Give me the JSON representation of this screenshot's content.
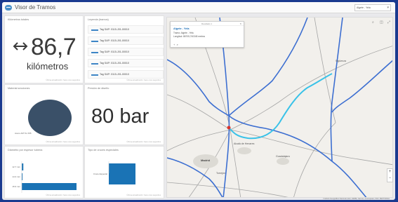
{
  "header": {
    "app_title": "Visor de Tramos",
    "layer_select_value": "Algete - Yela"
  },
  "panels": {
    "distance": {
      "title": "Kilómetros totales",
      "value": "86,7",
      "unit": "kilómetros",
      "foot": "Última actualización: hace unos segundos"
    },
    "legend": {
      "title": "Leyenda (tramos)",
      "items": [
        "Tag SAP: 0115-J01-00010",
        "Tag SAP: 0115-J01-00010",
        "Tag SAP: 0115-J01-00010",
        "Tag SAP: 0115-J01-00010",
        "Tag SAP: 0115-J01-00010"
      ],
      "foot": "Última actualización: hace unos segundos"
    },
    "material": {
      "title": "Material secciones",
      "pie_label": "Acero API 5L X65",
      "foot": "Última actualización: hace unos segundos"
    },
    "pressure": {
      "title": "Presión de diseño",
      "value": "80 bar",
      "foot": "Última actualización: hace unos segundos"
    },
    "diameter": {
      "title": "Diámetro por espesor tubería",
      "bar_labels": [
        "12.7 mm",
        "14.3 mm",
        "15.9 mm"
      ],
      "foot": "Última actualización: hace unos segundos"
    },
    "crossing": {
      "title": "Tipo de cruces especiales",
      "bar_label": "Cruce Especial",
      "foot": "Última actualización: hace unos segundos"
    }
  },
  "chart_data": [
    {
      "type": "pie",
      "title": "Material secciones",
      "slices": [
        {
          "label": "Acero API 5L X65",
          "value": 100
        }
      ]
    },
    {
      "type": "bar",
      "title": "Diámetro por espesor tubería",
      "orientation": "horizontal",
      "categories": [
        "12.7 mm",
        "14.3 mm",
        "15.9 mm"
      ],
      "values": [
        2,
        1,
        70
      ],
      "color": "#1a73b5"
    },
    {
      "type": "bar",
      "title": "Tipo de cruces especiales",
      "orientation": "horizontal",
      "categories": [
        "Cruce Especial"
      ],
      "values": [
        1
      ],
      "color": "#1a73b5"
    }
  ],
  "map": {
    "popup": {
      "pager": "Resultado 1",
      "title": "Algete - Yela",
      "lines": [
        "Tramo: Algete - Yela",
        "Longitud: 86705,740345 metros"
      ]
    },
    "places": [
      {
        "name": "Madrid",
        "bold": true
      },
      {
        "name": "Alcalá de Henares",
        "bold": false
      },
      {
        "name": "Guadalajara",
        "bold": false
      },
      {
        "name": "Torrejón",
        "bold": false
      },
      {
        "name": "Sigüenza",
        "bold": false
      }
    ],
    "attribution": "Instituto Geográfico Nacional, Esri, HERE, Garmin, Foursquare, FAO, METI/NASA",
    "colors": {
      "pipeline": "#39c2e8",
      "rivers": "#3d6fd1",
      "roads": "#9a9a9a",
      "marker": "#d9332b"
    }
  },
  "icons": [
    "logo-icon",
    "arrow-both-icon",
    "close-icon",
    "search-icon",
    "layers-icon",
    "zoom-in-icon",
    "zoom-out-icon"
  ]
}
